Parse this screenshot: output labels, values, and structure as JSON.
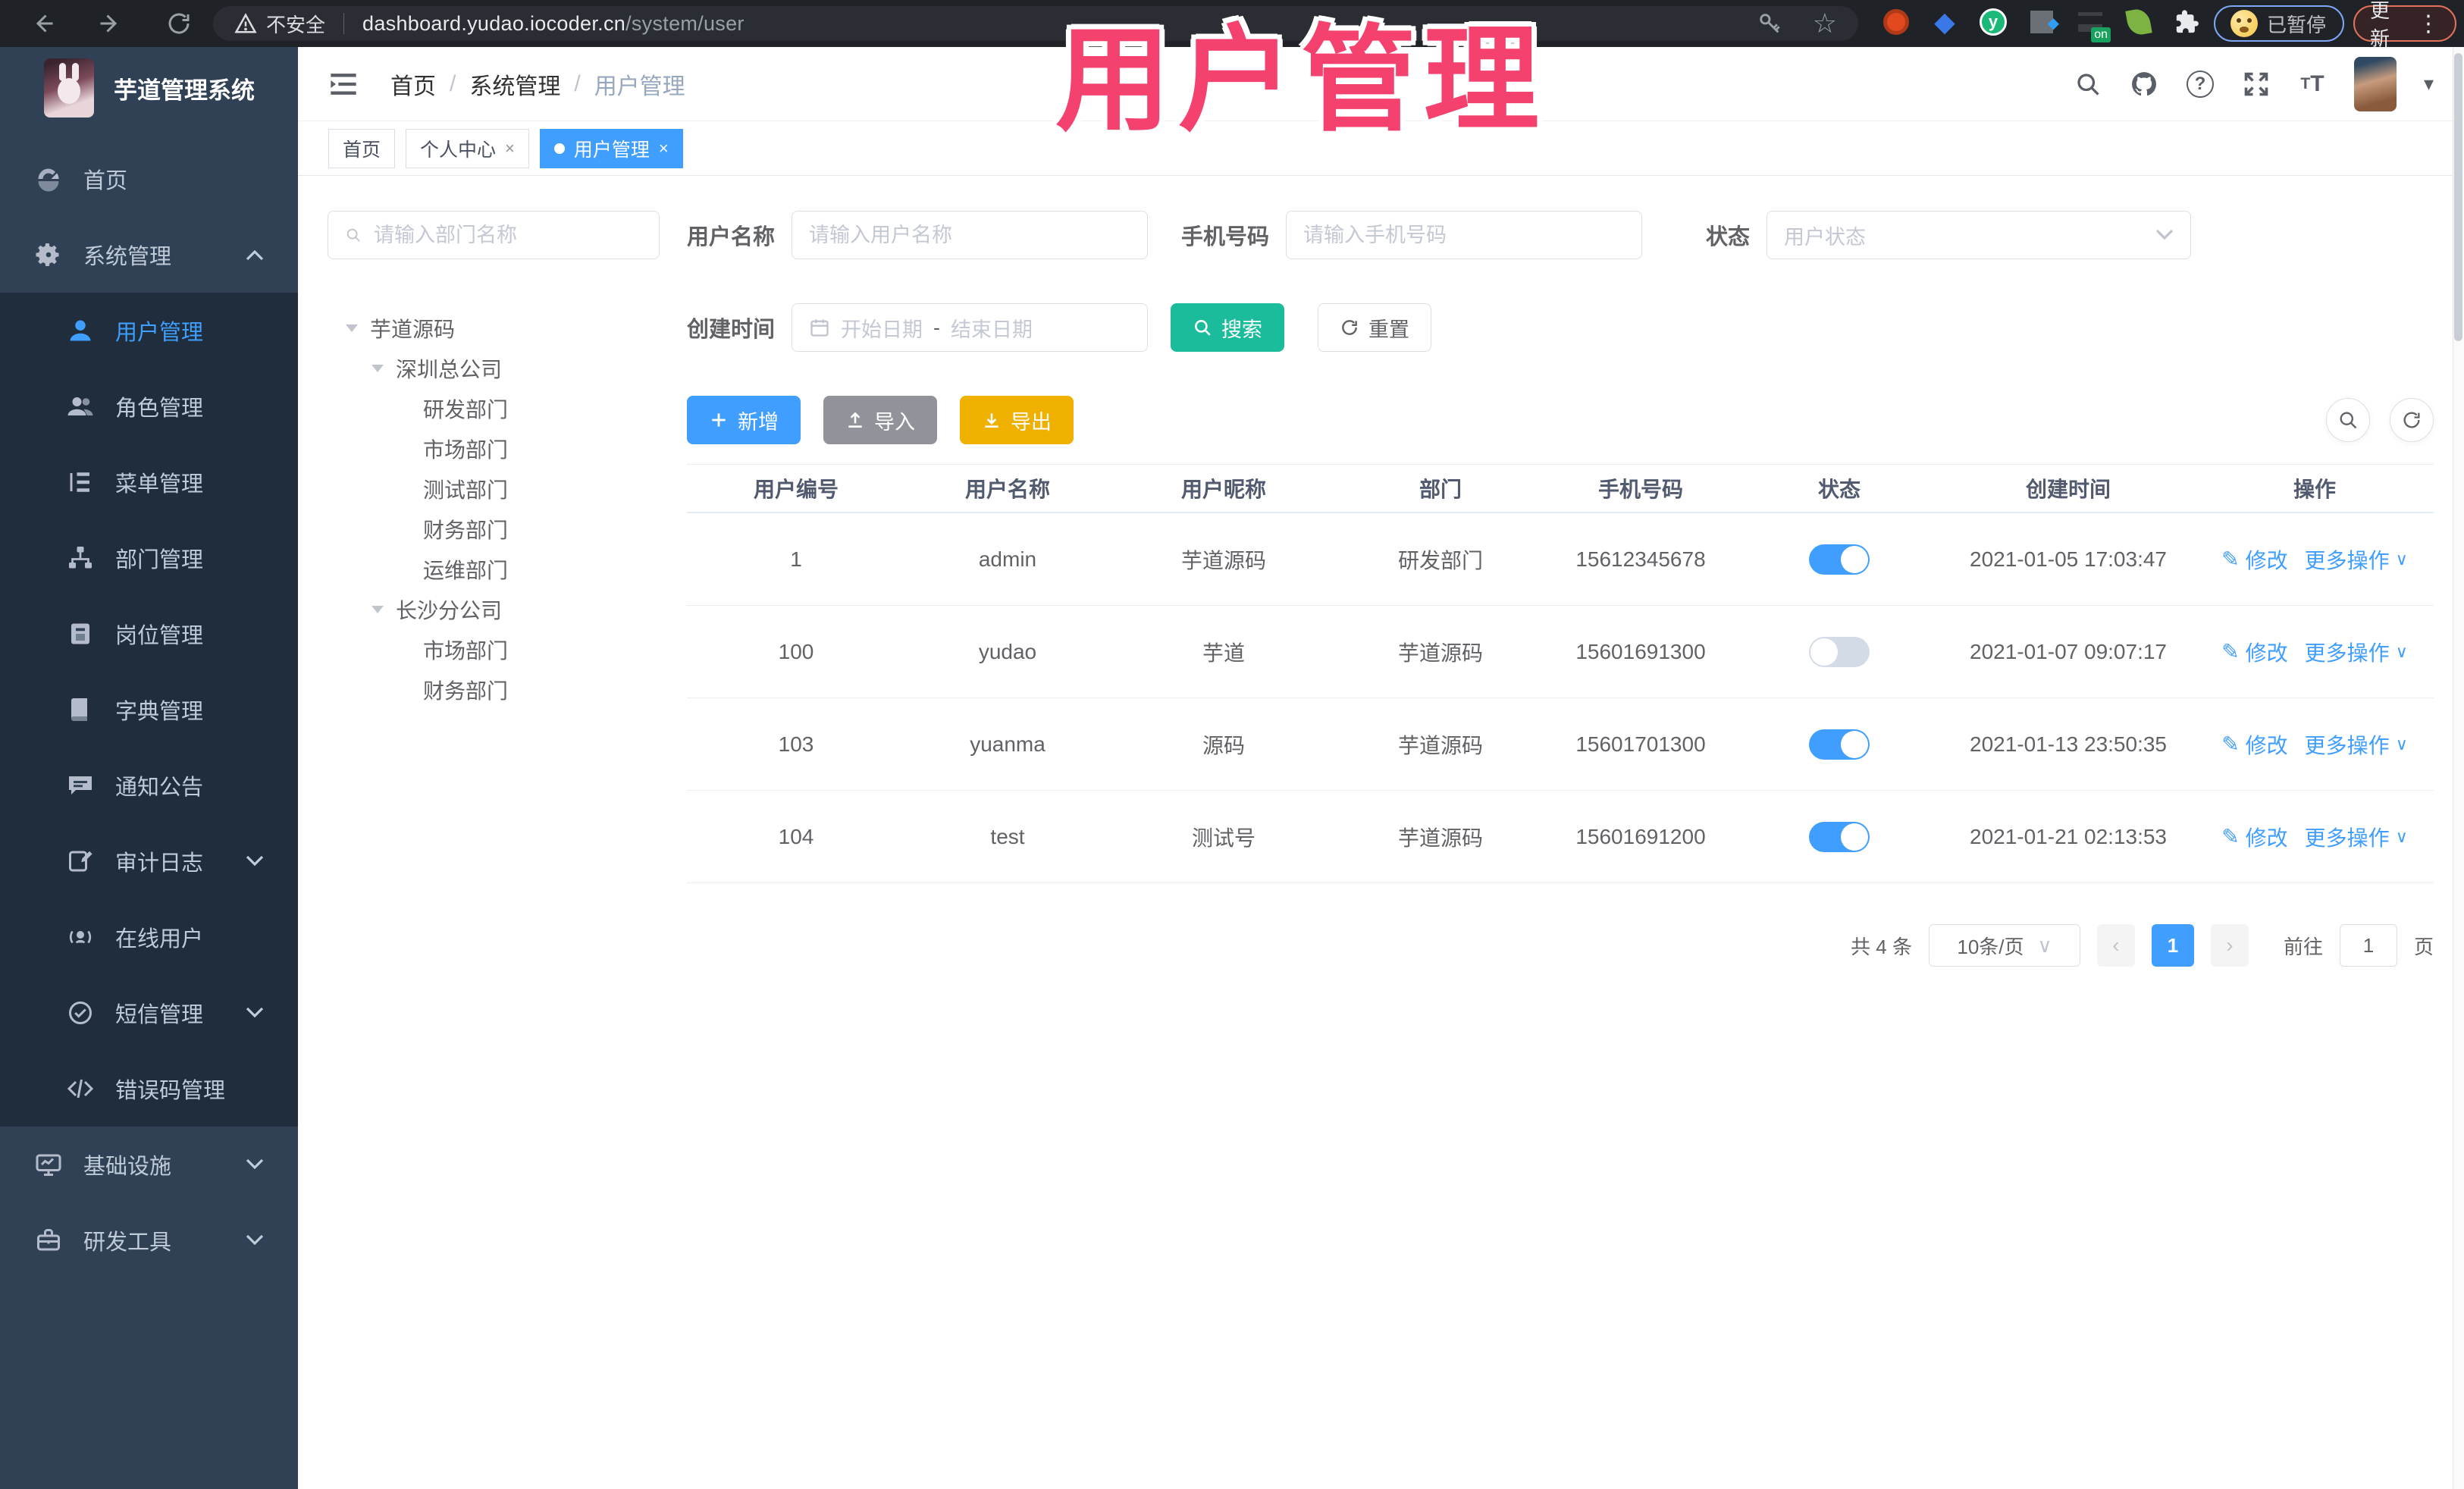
{
  "colors": {
    "accent_blue": "#409EFF",
    "search_teal": "#1ABC9C",
    "export_yellow": "#EFB000",
    "import_gray": "#909399",
    "overlay_pink": "#F4416E",
    "sidebar_bg": "#304156",
    "submenu_bg": "#1F2D3D",
    "browser_bg": "#1F2226"
  },
  "icons": {
    "edit": "✎",
    "star": "☆",
    "gem": "◆",
    "caret_down": "▾",
    "more_dots": "⋮",
    "chevron_down": "∨",
    "arrow_prev": "‹",
    "arrow_next": "›",
    "extension_badge": "on"
  },
  "browser": {
    "security_label": "不安全",
    "url_domain": "dashboard.yudao.iocoder.cn",
    "url_path": "/system/user",
    "paused_label": "已暂停",
    "update_label": "更新"
  },
  "overlay": {
    "text": "用户管理"
  },
  "sidebar": {
    "title": "芋道管理系统",
    "menu": [
      {
        "label": "首页"
      },
      {
        "label": "系统管理"
      },
      {
        "label": "用户管理"
      },
      {
        "label": "角色管理"
      },
      {
        "label": "菜单管理"
      },
      {
        "label": "部门管理"
      },
      {
        "label": "岗位管理"
      },
      {
        "label": "字典管理"
      },
      {
        "label": "通知公告"
      },
      {
        "label": "审计日志"
      },
      {
        "label": "在线用户"
      },
      {
        "label": "短信管理"
      },
      {
        "label": "错误码管理"
      },
      {
        "label": "基础设施"
      },
      {
        "label": "研发工具"
      }
    ]
  },
  "header": {
    "breadcrumb": [
      "首页",
      "系统管理",
      "用户管理"
    ]
  },
  "tabs": [
    {
      "label": "首页"
    },
    {
      "label": "个人中心"
    },
    {
      "label": "用户管理"
    }
  ],
  "filters": {
    "dept_search_placeholder": "请输入部门名称",
    "username_label": "用户名称",
    "username_placeholder": "请输入用户名称",
    "mobile_label": "手机号码",
    "mobile_placeholder": "请输入手机号码",
    "status_label": "状态",
    "status_placeholder": "用户状态",
    "created_label": "创建时间",
    "date_start_placeholder": "开始日期",
    "date_separator": "-",
    "date_end_placeholder": "结束日期",
    "search_label": "搜索",
    "reset_label": "重置"
  },
  "tree": {
    "nodes": [
      {
        "label": "芋道源码"
      },
      {
        "label": "深圳总公司"
      },
      {
        "label": "研发部门"
      },
      {
        "label": "市场部门"
      },
      {
        "label": "测试部门"
      },
      {
        "label": "财务部门"
      },
      {
        "label": "运维部门"
      },
      {
        "label": "长沙分公司"
      },
      {
        "label": "市场部门"
      },
      {
        "label": "财务部门"
      }
    ]
  },
  "toolbar": {
    "add_label": "新增",
    "import_label": "导入",
    "export_label": "导出"
  },
  "table": {
    "columns": [
      "用户编号",
      "用户名称",
      "用户昵称",
      "部门",
      "手机号码",
      "状态",
      "创建时间",
      "操作"
    ],
    "actions": {
      "edit": "修改",
      "more": "更多操作"
    },
    "rows": [
      {
        "id": "1",
        "username": "admin",
        "nickname": "芋道源码",
        "dept": "研发部门",
        "mobile": "15612345678",
        "status_on": true,
        "created": "2021-01-05 17:03:47"
      },
      {
        "id": "100",
        "username": "yudao",
        "nickname": "芋道",
        "dept": "芋道源码",
        "mobile": "15601691300",
        "status_on": false,
        "created": "2021-01-07 09:07:17"
      },
      {
        "id": "103",
        "username": "yuanma",
        "nickname": "源码",
        "dept": "芋道源码",
        "mobile": "15601701300",
        "status_on": true,
        "created": "2021-01-13 23:50:35"
      },
      {
        "id": "104",
        "username": "test",
        "nickname": "测试号",
        "dept": "芋道源码",
        "mobile": "15601691200",
        "status_on": true,
        "created": "2021-01-21 02:13:53"
      }
    ]
  },
  "pagination": {
    "total_label": "共 4 条",
    "page_size_label": "10条/页",
    "current_page": "1",
    "goto_label": "前往",
    "goto_value": "1",
    "page_unit_label": "页"
  }
}
